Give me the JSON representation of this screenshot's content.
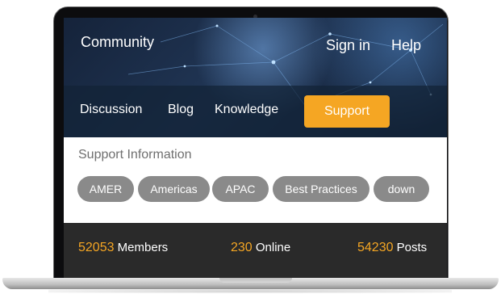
{
  "header": {
    "brand": "Community",
    "links": [
      "Sign in",
      "Help"
    ]
  },
  "nav": {
    "items": [
      "Discussion",
      "Blog",
      "Knowledge"
    ],
    "active": "Support"
  },
  "support": {
    "title": "Support Information",
    "tags": [
      "AMER",
      "Americas",
      "APAC",
      "Best Practices",
      "down"
    ]
  },
  "stats": {
    "members": {
      "value": "52053",
      "label": "Members"
    },
    "online": {
      "value": "230",
      "label": "Online"
    },
    "posts": {
      "value": "54230",
      "label": "Posts"
    }
  },
  "colors": {
    "accent": "#f5a623",
    "tag_bg": "#8a8a8a",
    "stats_bg": "#2a2a2a",
    "hero_bg": "#1d2a3a"
  }
}
